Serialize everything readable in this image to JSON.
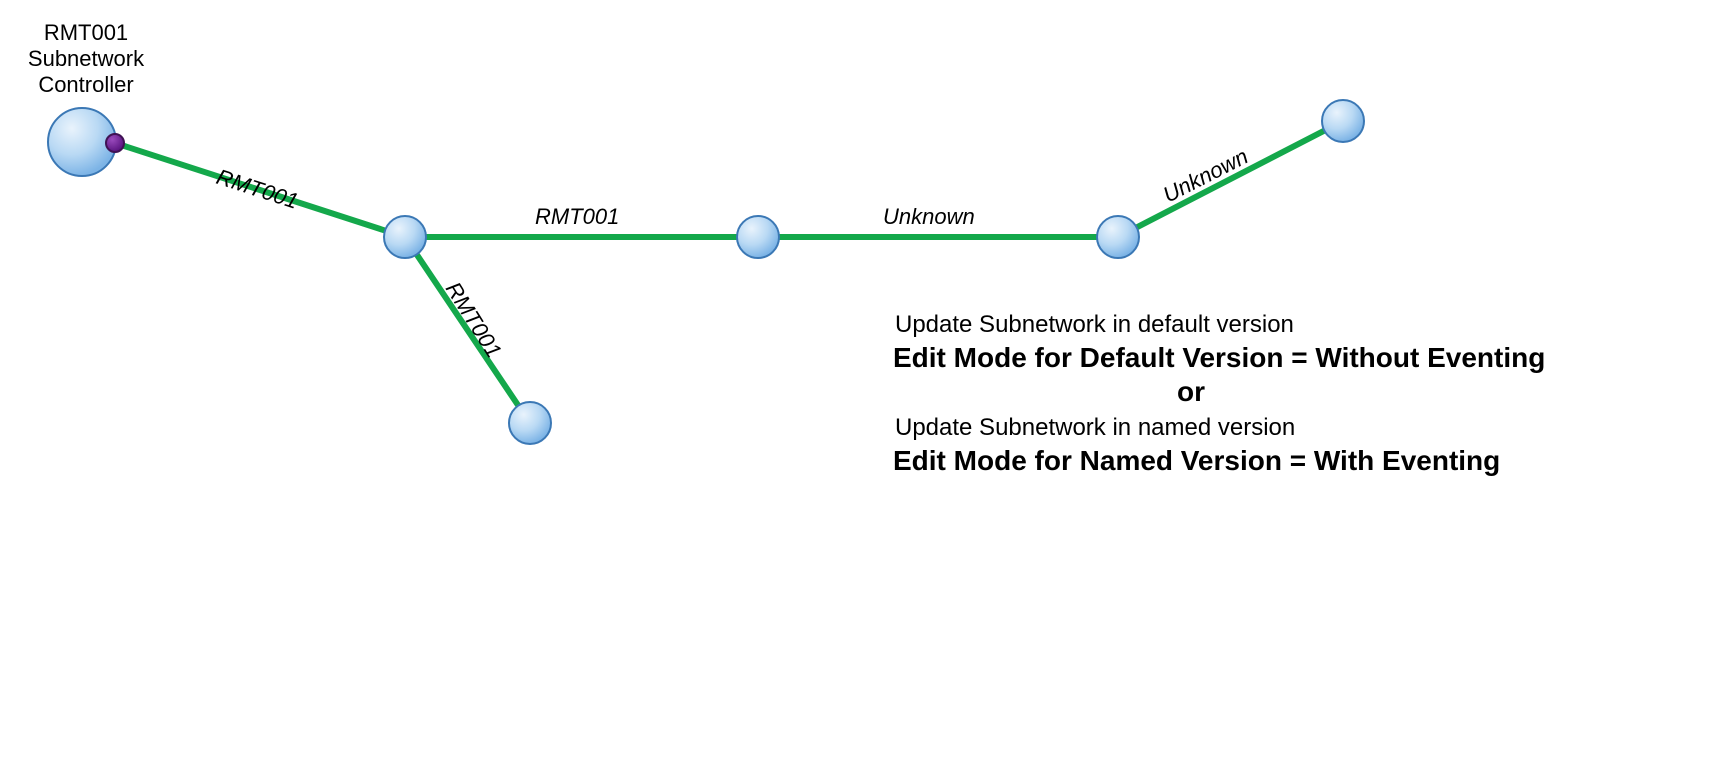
{
  "nodes": {
    "controller": {
      "label_line1": "RMT001",
      "label_line2": "Subnetwork",
      "label_line3": "Controller"
    }
  },
  "edges": {
    "e1": {
      "label": "RMT001"
    },
    "e2": {
      "label": "RMT001"
    },
    "e3": {
      "label": "RMT001"
    },
    "e4": {
      "label": "Unknown"
    },
    "e5": {
      "label": "Unknown"
    }
  },
  "caption": {
    "line1": "Update Subnetwork in default version",
    "line2": "Edit Mode for Default Version = Without Eventing",
    "line3": "or",
    "line4": "Update Subnetwork in named version",
    "line5": "Edit Mode for Named Version = With Eventing"
  },
  "colors": {
    "edge": "#14a84b",
    "node_fill_top": "#d2e7fa",
    "node_fill_bottom": "#8bbdeb",
    "node_stroke": "#3b78b5",
    "port_fill": "#6b1f8a",
    "port_stroke": "#401254"
  }
}
